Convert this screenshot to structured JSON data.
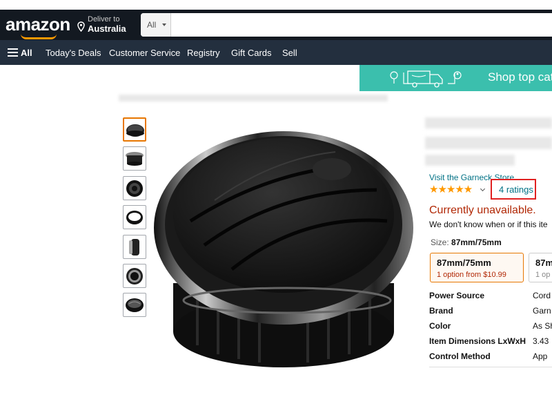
{
  "header": {
    "logo": "amazon",
    "deliver_line1": "Deliver to",
    "deliver_line2": "Australia",
    "search_category": "All",
    "search_placeholder": ""
  },
  "nav": {
    "items": [
      "All",
      "Today's Deals",
      "Customer Service",
      "Registry",
      "Gift Cards",
      "Sell"
    ]
  },
  "banner": {
    "text": "Shop top cat"
  },
  "product": {
    "store_link": "Visit the Garneck Store",
    "rating_stars": 5,
    "ratings_link": "4 ratings",
    "availability": "Currently unavailable.",
    "availability_note": "We don't know when or if this ite",
    "size_label": "Size:",
    "size_value": "87mm/75mm",
    "options": [
      {
        "name": "87mm/75mm",
        "price": "1 option from $10.99"
      },
      {
        "name": "87m",
        "price": "1 op"
      }
    ],
    "specs": [
      {
        "key": "Power Source",
        "value": "Cord"
      },
      {
        "key": "Brand",
        "value": "Garn"
      },
      {
        "key": "Color",
        "value": "As Sh"
      },
      {
        "key": "Item Dimensions LxWxH",
        "value": "3.43"
      },
      {
        "key": "Control Method",
        "value": "App"
      }
    ]
  },
  "colors": {
    "header_bg": "#131921",
    "nav_bg": "#232f3e",
    "accent_orange": "#ff9900",
    "link_teal": "#007185",
    "price_red": "#b12704",
    "banner_teal": "#3bbfad",
    "highlight_box": "#e02020"
  }
}
